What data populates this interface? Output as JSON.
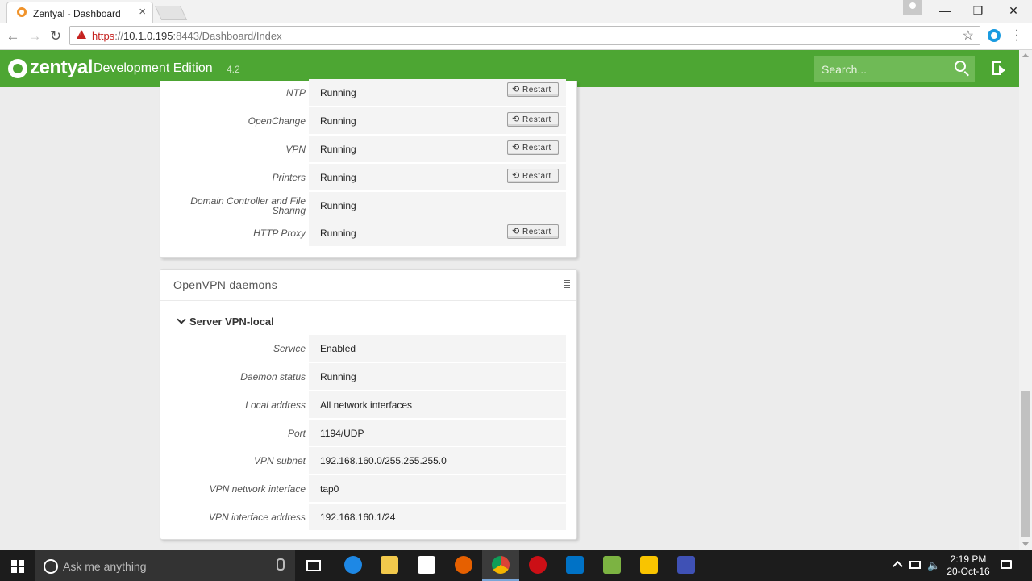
{
  "browser": {
    "tab_title": "Zentyal - Dashboard",
    "tab_close": "×",
    "url_scheme": "https",
    "url_sep": "://",
    "url_host": "10.1.0.195",
    "url_rest": ":8443/Dashboard/Index",
    "window_min": "—",
    "window_restore": "❐",
    "window_close": "✕"
  },
  "header": {
    "logo_text": "zentyal",
    "edition": "Development Edition",
    "version": "4.2",
    "search_placeholder": "Search..."
  },
  "services": {
    "rows": [
      {
        "name": "NTP",
        "status": "Running",
        "action": "Restart"
      },
      {
        "name": "OpenChange",
        "status": "Running",
        "action": "Restart"
      },
      {
        "name": "VPN",
        "status": "Running",
        "action": "Restart"
      },
      {
        "name": "Printers",
        "status": "Running",
        "action": "Restart"
      },
      {
        "name": "Domain Controller and File Sharing",
        "status": "Running"
      },
      {
        "name": "HTTP Proxy",
        "status": "Running",
        "action": "Restart"
      }
    ]
  },
  "openvpn": {
    "title": "OpenVPN daemons",
    "server_name": "Server VPN-local",
    "rows": [
      {
        "label": "Service",
        "value": "Enabled"
      },
      {
        "label": "Daemon status",
        "value": "Running"
      },
      {
        "label": "Local address",
        "value": "All network interfaces"
      },
      {
        "label": "Port",
        "value": "1194/UDP"
      },
      {
        "label": "VPN subnet",
        "value": "192.168.160.0/255.255.255.0"
      },
      {
        "label": "VPN network interface",
        "value": "tap0"
      },
      {
        "label": "VPN interface address",
        "value": "192.168.160.1/24"
      }
    ]
  },
  "taskbar": {
    "search_text": "Ask me anything",
    "time": "2:19 PM",
    "date": "20-Oct-16",
    "apps": [
      {
        "name": "task-view",
        "color": "#ffffff"
      },
      {
        "name": "edge",
        "color": "#1e88e5"
      },
      {
        "name": "file-explorer",
        "color": "#f2c94c"
      },
      {
        "name": "store",
        "color": "#ffffff"
      },
      {
        "name": "firefox",
        "color": "#e66000"
      },
      {
        "name": "chrome",
        "color": "#4caf50"
      },
      {
        "name": "opera",
        "color": "#cc0f16"
      },
      {
        "name": "outlook",
        "color": "#0072c6"
      },
      {
        "name": "notepad-plus",
        "color": "#7cb342"
      },
      {
        "name": "virtualbox-vm",
        "color": "#f9c400"
      },
      {
        "name": "network-app",
        "color": "#3f51b5"
      }
    ]
  },
  "colors": {
    "brand_green": "#4da633",
    "chrome_tab": "#ffffff",
    "taskbar": "#1c1c1c"
  }
}
